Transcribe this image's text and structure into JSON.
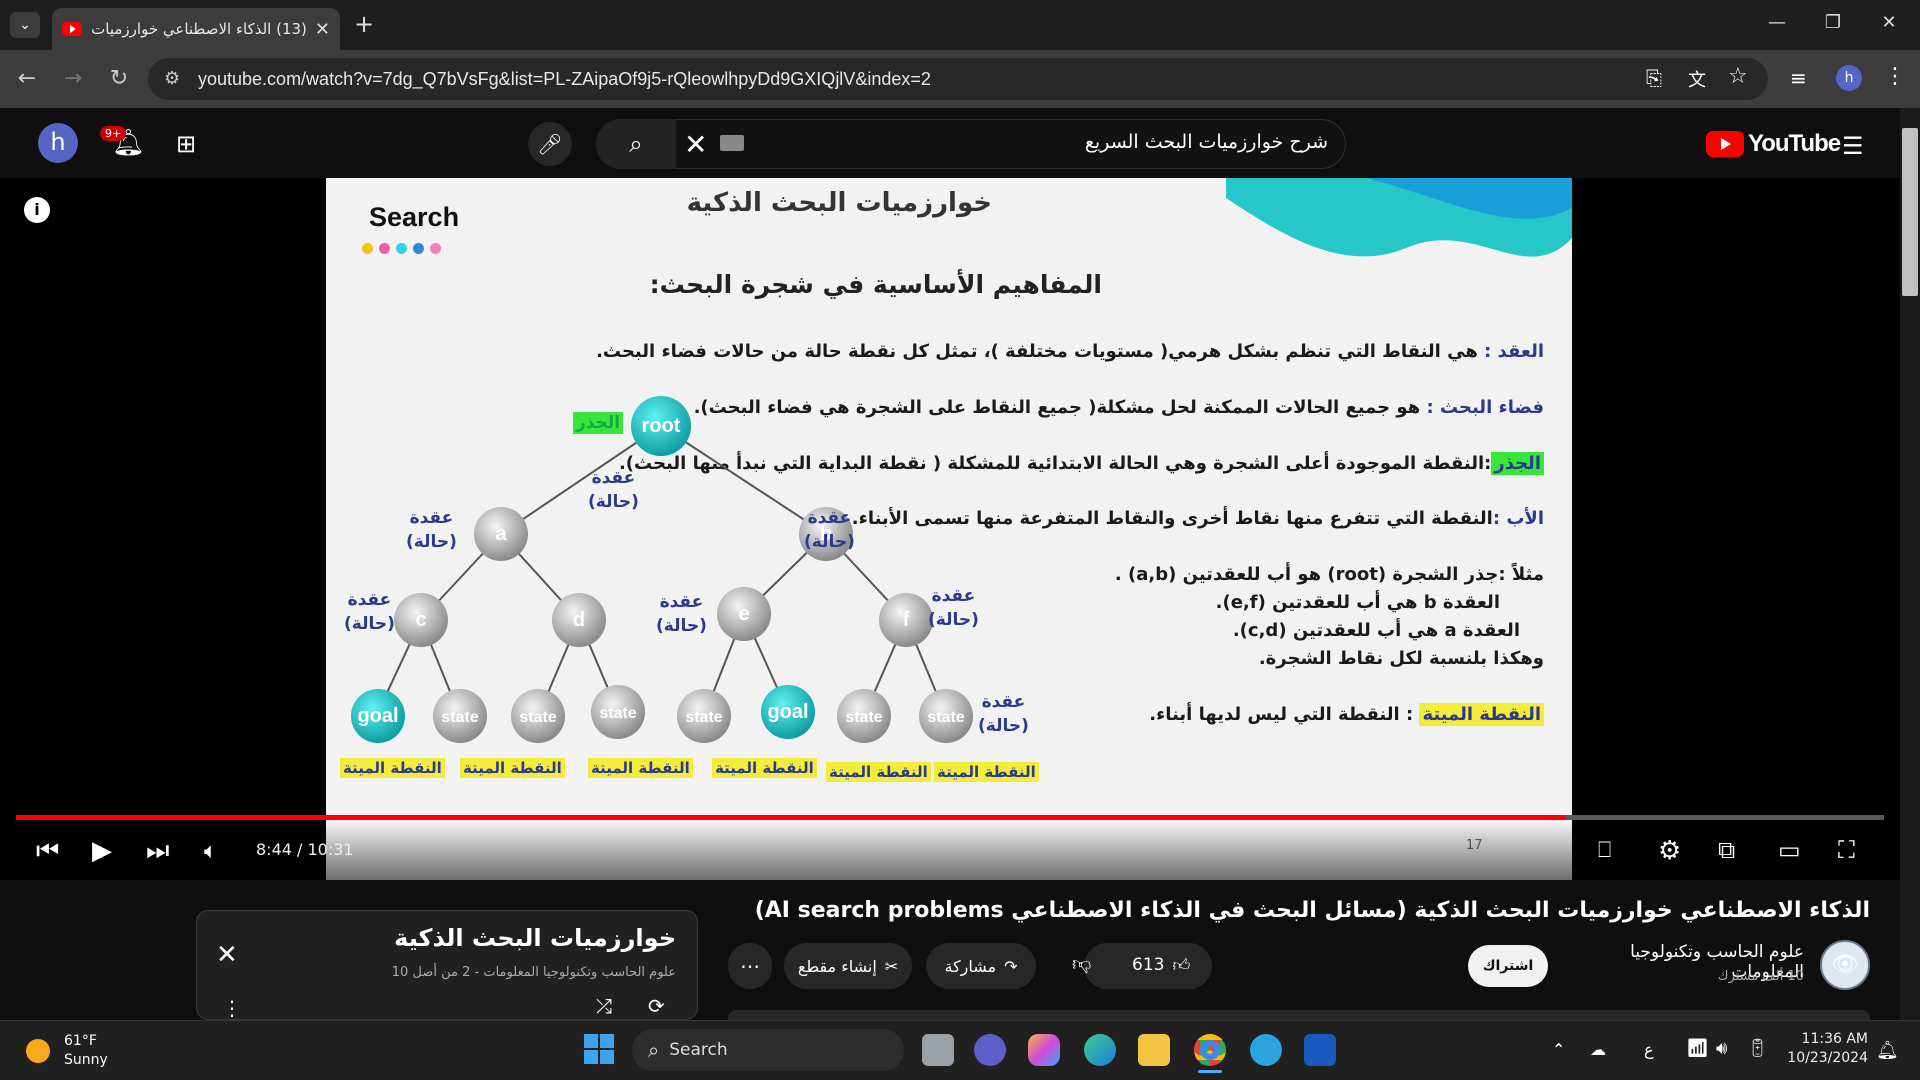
{
  "browser": {
    "tab_title": "(13) الذكاء الاصطناعي خوارزميات",
    "url": "youtube.com/watch?v=7dg_Q7bVsFg&list=PL-ZAipaOf9j5-rQleowlhpyDd9GXIQjlV&index=2",
    "profile_initial": "h"
  },
  "youtube": {
    "logo_text": "YouTube",
    "search_query": "شرح خوارزميات البحث السريع",
    "notification_count": "9+",
    "avatar_initial": "h"
  },
  "slide": {
    "logo": "Search",
    "header": "خوارزميات البحث الذكية",
    "subtitle": "المفاهيم الأساسية في شجرة البحث:",
    "def_node_term": "العقد :",
    "def_node": "هي النقاط التي تنظم بشكل هرمي( مستويات مختلفة )، تمثل كل نقطة حالة من حالات فضاء البحث.",
    "def_space_term": "فضاء البحث :",
    "def_space": "هو جميع الحالات الممكنة لحل مشكلة( جميع النقاط على الشجرة هي فضاء البحث).",
    "def_root_term": "الجذر",
    "def_root": ":النقطة الموجودة أعلى الشجرة وهي الحالة الابتدائية للمشكلة ( نقطة البداية التي نبدأ منها البحث).",
    "def_parent_term": "الأب :",
    "def_parent": "النقطة التي تتفرع منها نقاط أخرى والنقاط المتفرعة منها تسمى الأبناء.",
    "example_1": "مثلاً :جذر الشجرة (root) هو أب للعقدتين (a,b) .",
    "example_2": "العقدة  b هي أب للعقدتين (e,f).",
    "example_3": "العقدة  a هي أب للعقدتين (c,d).",
    "example_4": "وهكذا بلنسبة لكل نقاط الشجرة.",
    "def_leaf_term": "النقطة الميتة",
    "def_leaf": ": النقطة التي ليس لديها أبناء.",
    "root_tag": "الجذر",
    "node_label": "عقدة",
    "state_label": "(حالة)",
    "leaf_label": "النقطة الميتة",
    "page_number": "17",
    "tree_nodes": [
      "root",
      "a",
      "b",
      "c",
      "d",
      "e",
      "f",
      "goal",
      "state",
      "state",
      "state",
      "state",
      "goal",
      "state",
      "state"
    ]
  },
  "player": {
    "time": "8:44 / 10:31",
    "progress_fraction": 0.83
  },
  "video": {
    "title": "الذكاء الاصطناعي خوارزميات البحث الذكية (مسائل البحث في الذكاء الاصطناعي AI search problems)",
    "channel_name": "علوم الحاسب وتكنولوجيا المعلومات",
    "subscribers": "10 ألف مشترك",
    "subscribe_label": "اشتراك",
    "likes": "613",
    "share_label": "مشاركة",
    "clip_label": "إنشاء مقطع",
    "more_label": "⋯"
  },
  "playlist": {
    "title": "خوارزميات البحث الذكية",
    "subtitle": "علوم الحاسب وتكنولوجيا المعلومات - 2 من أصل 10"
  },
  "taskbar": {
    "temperature": "61°F",
    "condition": "Sunny",
    "search_label": "Search",
    "ime": "ع",
    "time": "11:36 AM",
    "date": "10/23/2024"
  }
}
